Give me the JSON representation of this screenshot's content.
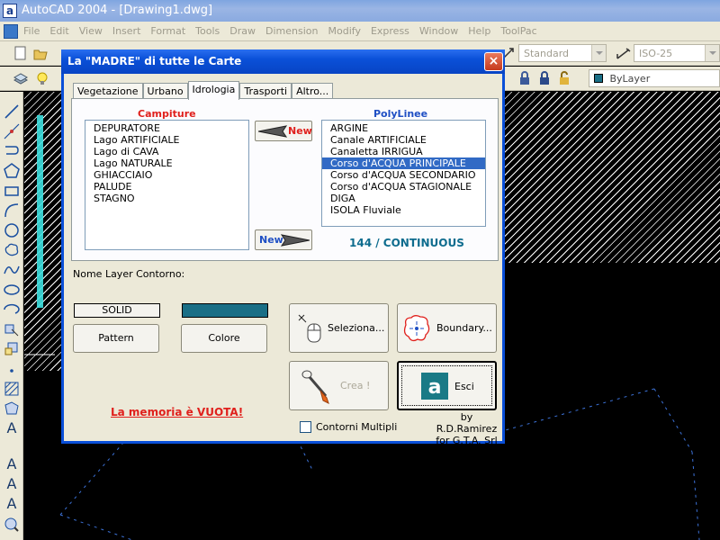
{
  "window": {
    "app_icon": "a",
    "title": "AutoCAD 2004 - [Drawing1.dwg]"
  },
  "menu": [
    "File",
    "Edit",
    "View",
    "Insert",
    "Format",
    "Tools",
    "Draw",
    "Dimension",
    "Modify",
    "Express",
    "Window",
    "Help",
    "ToolPac"
  ],
  "toolbar": {
    "text_style": "Standard",
    "dim_style": "ISO-25",
    "color": "ByLayer"
  },
  "dialog": {
    "title": "La \"MADRE\" di tutte le Carte",
    "close_label": "×",
    "tabs": [
      "Vegetazione",
      "Urbano",
      "Idrologia",
      "Trasporti",
      "Altro..."
    ],
    "active_tab": "Idrologia",
    "campiture": {
      "label": "Campiture",
      "items": [
        "DEPURATORE",
        "Lago ARTIFICIALE",
        "Lago di CAVA",
        "Lago NATURALE",
        "GHIACCIAIO",
        "PALUDE",
        "STAGNO"
      ]
    },
    "polylinee": {
      "label": "PolyLinee",
      "items": [
        "ARGINE",
        "Canale ARTIFICIALE",
        "Canaletta IRRIGUA",
        "Corso d'ACQUA PRINCIPALE",
        "Corso d'ACQUA SECONDARIO",
        "Corso d'ACQUA STAGIONALE",
        "DIGA",
        "ISOLA Fluviale"
      ],
      "selected": "Corso d'ACQUA PRINCIPALE"
    },
    "new_left_label": "New",
    "new_right_label": "New",
    "layer_type": "144 / CONTINUOUS",
    "nome_layer_label": "Nome Layer Contorno:",
    "pattern_value": "SOLID",
    "pattern_button": "Pattern",
    "color_value": "#1a6f86",
    "colore_button": "Colore",
    "seleziona_button": "Seleziona...",
    "boundary_button": "Boundary...",
    "crea_button": "Crea !",
    "esci_button": "Esci",
    "memoria_text": "La memoria è VUOTA!",
    "contorni_label": "Contorni Multipli",
    "credit_line1": "by R.D.Ramirez",
    "credit_line2": "for G.T.A. Srl"
  }
}
